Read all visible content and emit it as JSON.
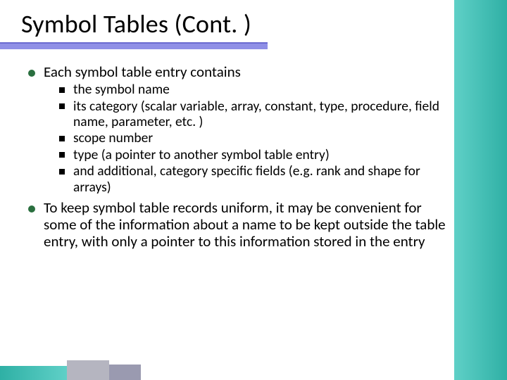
{
  "title": "Symbol Tables (Cont. )",
  "bullets": [
    {
      "text": "Each symbol table entry contains",
      "sub": [
        "the symbol name",
        "its category (scalar variable, array, constant, type, procedure, field name, parameter, etc. )",
        "scope number",
        "type (a pointer to another symbol table entry)",
        "and additional, category specific fields (e.g. rank and shape for arrays)"
      ]
    },
    {
      "text": "To keep symbol table records uniform, it may be convenient for some of the information about a name to be kept outside the table entry, with only a pointer to this information stored in the entry",
      "sub": []
    }
  ]
}
